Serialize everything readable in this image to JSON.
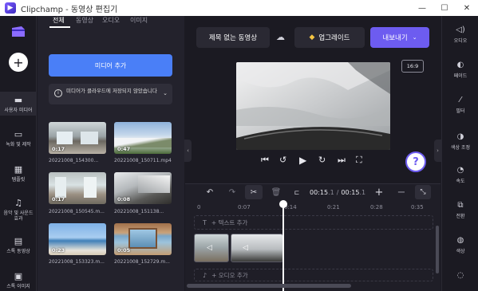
{
  "window": {
    "app_name": "Clipchamp - 동영상 편집기",
    "minimize": "—",
    "maximize": "☐",
    "close": "✕"
  },
  "left_rail": {
    "items": [
      {
        "label": "",
        "icon": "plus-icon"
      },
      {
        "label": "사용자 미디어",
        "icon": "folder-icon"
      },
      {
        "label": "녹화 및 제작",
        "icon": "camera-icon"
      },
      {
        "label": "템플릿",
        "icon": "template-icon"
      },
      {
        "label": "음악 및 사운드 효과",
        "icon": "music-icon"
      },
      {
        "label": "스톡 동영상",
        "icon": "film-icon"
      },
      {
        "label": "스톡 이미지",
        "icon": "image-icon"
      }
    ]
  },
  "media_panel": {
    "tabs": [
      "전체",
      "동영상",
      "오디오",
      "이미지"
    ],
    "active_tab": 0,
    "add_media_label": "미디어 추가",
    "notice_text": "미디어가 클라우드에 저장되지 않았습니다",
    "thumbnails": [
      {
        "duration": "0:17",
        "filename": "20221008_154300..."
      },
      {
        "duration": "0:47",
        "filename": "20221008_150711.mp4"
      },
      {
        "duration": "0:17",
        "filename": "20221008_150545.m..."
      },
      {
        "duration": "0:08",
        "filename": "20221008_151138..."
      },
      {
        "duration": "0:23",
        "filename": "20221008_153323.m..."
      },
      {
        "duration": "0:05",
        "filename": "20221008_152729.m..."
      }
    ]
  },
  "header": {
    "project_title": "제목 없는 동영상",
    "upgrade_label": "업그레이드",
    "export_label": "내보내기"
  },
  "preview": {
    "aspect_ratio": "16:9"
  },
  "timeline": {
    "current_time": "00:15",
    "current_frame": ".1",
    "total_time": "00:15",
    "total_frame": ".1",
    "ticks": [
      "0",
      "0:07",
      "0:14",
      "0:21",
      "0:28",
      "0:35"
    ],
    "text_track_label": "+ 텍스트 추가",
    "audio_track_label": "+ 오디오 추가"
  },
  "right_rail": {
    "items": [
      {
        "label": "오디오",
        "icon": "speaker-icon"
      },
      {
        "label": "페이드",
        "icon": "fade-icon"
      },
      {
        "label": "필터",
        "icon": "magic-wand-icon"
      },
      {
        "label": "색상 조정",
        "icon": "contrast-icon"
      },
      {
        "label": "속도",
        "icon": "speedometer-icon"
      },
      {
        "label": "전환",
        "icon": "transition-icon"
      },
      {
        "label": "색상",
        "icon": "palette-icon"
      },
      {
        "label": "",
        "icon": "more-icon"
      }
    ]
  },
  "colors": {
    "accent_blue": "#4a7ff7",
    "accent_purple": "#6d5cf0",
    "background": "#1b1a22",
    "panel": "#23222c"
  }
}
